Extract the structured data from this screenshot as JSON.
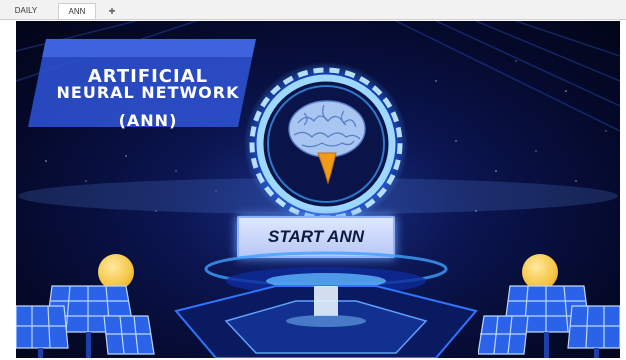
{
  "tabs": [
    {
      "label": "DAILY"
    },
    {
      "label": "ANN",
      "active": true
    },
    {
      "label": "+"
    }
  ],
  "title_panel": {
    "line1": "ARTIFICIAL",
    "line2": "NEURAL NETWORK",
    "line3": "(ANN)"
  },
  "start_button": {
    "label": "START ANN"
  },
  "icons": [
    "brain-icon",
    "ring-icon",
    "sun-icon",
    "solar-panel-icon",
    "hologram-platform"
  ],
  "colors": {
    "background_dark": "#050a2e",
    "accent_blue": "#3fa0ff",
    "ring_light": "#c9f0ff",
    "button_bg": "#cfdcff",
    "brain_orange": "#f29a1a",
    "sun_yellow": "#f5c542",
    "panel_blue": "#2a63e8"
  }
}
